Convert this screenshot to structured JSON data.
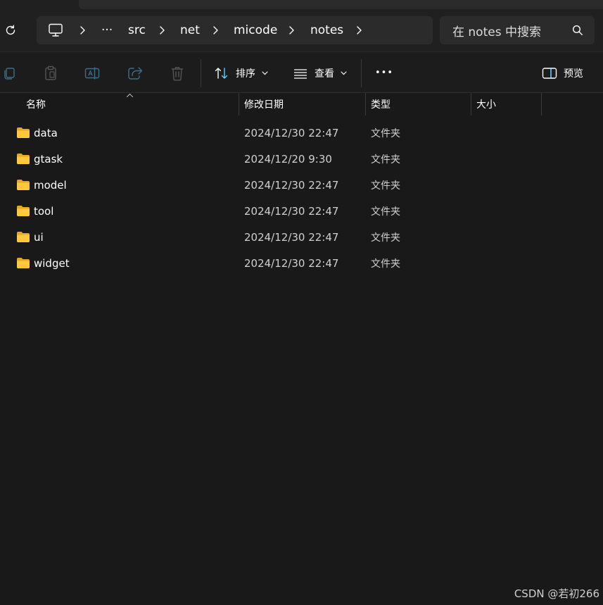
{
  "colors": {
    "background": "#191919",
    "bar": "#202020",
    "field": "#2b2b2b",
    "accent": "#60cdff",
    "folder": "#ffc83d"
  },
  "breadcrumb": {
    "icon": "computer-icon",
    "overflow": "···",
    "items": [
      "src",
      "net",
      "micode",
      "notes"
    ]
  },
  "search": {
    "placeholder": "在 notes 中搜索"
  },
  "toolbar": {
    "sort_label": "排序",
    "view_label": "查看",
    "more_label": "•••",
    "preview_label": "预览"
  },
  "columns": {
    "name": "名称",
    "date": "修改日期",
    "type": "类型",
    "size": "大小"
  },
  "files": [
    {
      "name": "data",
      "date": "2024/12/30 22:47",
      "type": "文件夹"
    },
    {
      "name": "gtask",
      "date": "2024/12/20 9:30",
      "type": "文件夹"
    },
    {
      "name": "model",
      "date": "2024/12/30 22:47",
      "type": "文件夹"
    },
    {
      "name": "tool",
      "date": "2024/12/30 22:47",
      "type": "文件夹"
    },
    {
      "name": "ui",
      "date": "2024/12/30 22:47",
      "type": "文件夹"
    },
    {
      "name": "widget",
      "date": "2024/12/30 22:47",
      "type": "文件夹"
    }
  ],
  "watermark": "CSDN @若初266"
}
